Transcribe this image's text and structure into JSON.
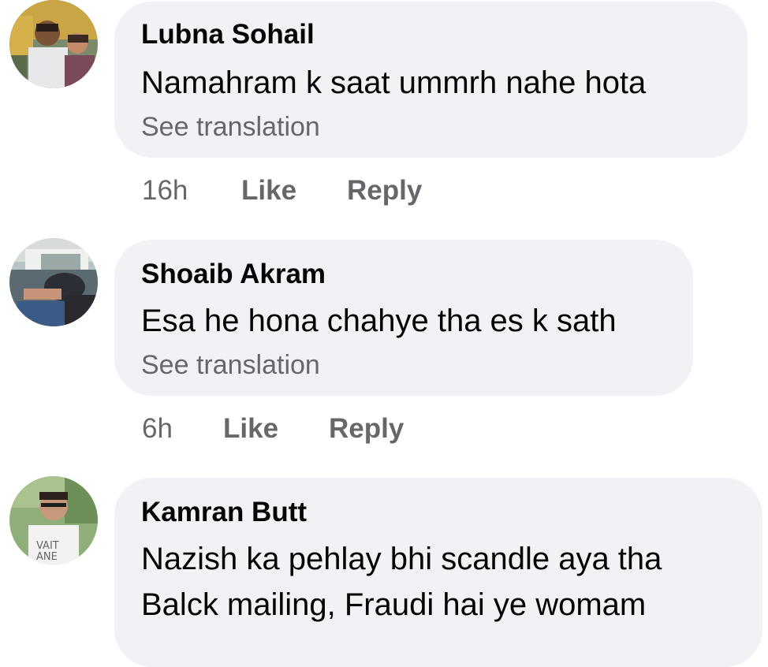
{
  "comments": [
    {
      "author": "Lubna Sohail",
      "text": "Namahram k saat  ummrh nahe hota",
      "translate": "See translation",
      "time": "16h",
      "like": "Like",
      "reply": "Reply"
    },
    {
      "author": "Shoaib Akram",
      "text": "Esa he hona chahye tha es k sath",
      "translate": "See translation",
      "time": "6h",
      "like": "Like",
      "reply": "Reply"
    },
    {
      "author": "Kamran Butt",
      "text_line1": "Nazish ka pehlay bhi scandle aya tha",
      "text_line2": "Balck mailing, Fraudi hai ye womam"
    }
  ],
  "colors": {
    "bubble": "#f0f2f5",
    "primary_text": "#050505",
    "secondary_text": "#65676b"
  }
}
